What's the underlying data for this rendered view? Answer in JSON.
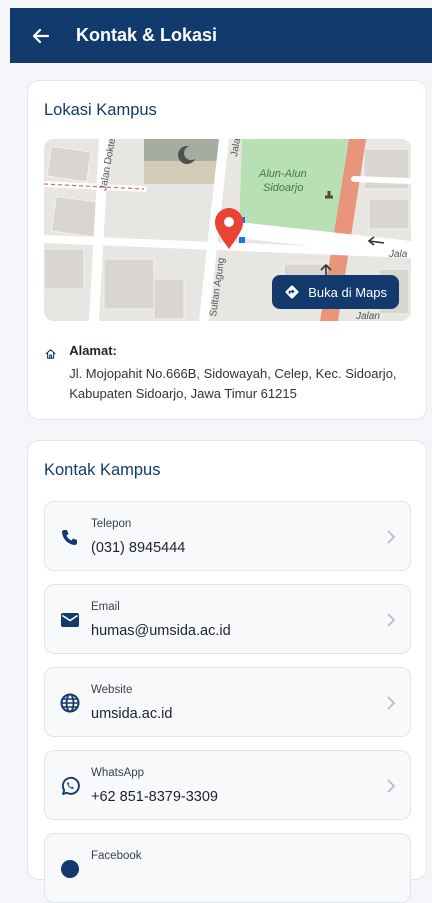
{
  "appbar": {
    "title": "Kontak & Lokasi"
  },
  "location": {
    "heading": "Lokasi Kampus",
    "map": {
      "labels": {
        "street1": "Jalan Dokte",
        "street2": "Jala",
        "park": "Alun-Alun",
        "park2": "Sidoarjo",
        "street3": "Sultan Agung",
        "street4": "Jala",
        "street5": "Jalan"
      },
      "button": "Buka di Maps"
    },
    "address_label": "Alamat:",
    "address": "Jl. Mojopahit No.666B, Sidowayah, Celep, Kec. Sidoarjo, Kabupaten Sidoarjo, Jawa Timur 61215"
  },
  "contact": {
    "heading": "Kontak Kampus",
    "items": [
      {
        "label": "Telepon",
        "value": "(031) 8945444",
        "icon": "phone-icon"
      },
      {
        "label": "Email",
        "value": "humas@umsida.ac.id",
        "icon": "mail-icon"
      },
      {
        "label": "Website",
        "value": "umsida.ac.id",
        "icon": "globe-icon"
      },
      {
        "label": "WhatsApp",
        "value": "+62 851-8379-3309",
        "icon": "whatsapp-icon"
      },
      {
        "label": "Facebook",
        "value": "",
        "icon": "facebook-icon"
      }
    ]
  },
  "colors": {
    "primary": "#133a6d",
    "pin": "#e94335",
    "park": "#b9dfb5",
    "road_main": "#e8957b"
  }
}
